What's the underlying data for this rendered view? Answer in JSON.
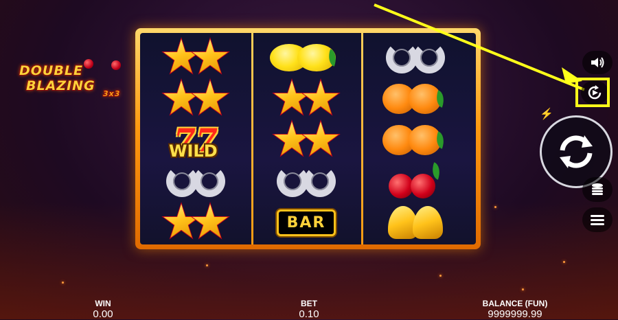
{
  "logo": {
    "line1": "DOUBLE",
    "line2": "BLAZING",
    "line3": "3x3"
  },
  "reels": {
    "reel1": [
      "stars",
      "stars",
      "wild",
      "horseshoes",
      "stars"
    ],
    "reel2": [
      "lemons",
      "stars",
      "stars",
      "horseshoes",
      "bar"
    ],
    "reel3": [
      "horseshoes",
      "oranges",
      "oranges",
      "cherries",
      "bells"
    ]
  },
  "symbols": {
    "wild_seven": "77",
    "wild_label": "WILD",
    "bar_label": "BAR"
  },
  "controls": {
    "sound_icon": "speaker-icon",
    "autoplay_icon": "autoplay-icon",
    "spin_icon": "spin-arrows-icon",
    "bet_icon": "coins-stack-icon",
    "menu_icon": "hamburger-icon",
    "turbo_icon": "lightning-icon"
  },
  "annotation": {
    "highlight_color": "#ffff1a"
  },
  "status": {
    "win_label": "WIN",
    "win_value": "0.00",
    "bet_label": "BET",
    "bet_value": "0.10",
    "balance_label": "BALANCE (FUN)",
    "balance_value": "9999999.99"
  },
  "colors": {
    "frame": "#ff9a10",
    "accent": "#ffd23a"
  }
}
